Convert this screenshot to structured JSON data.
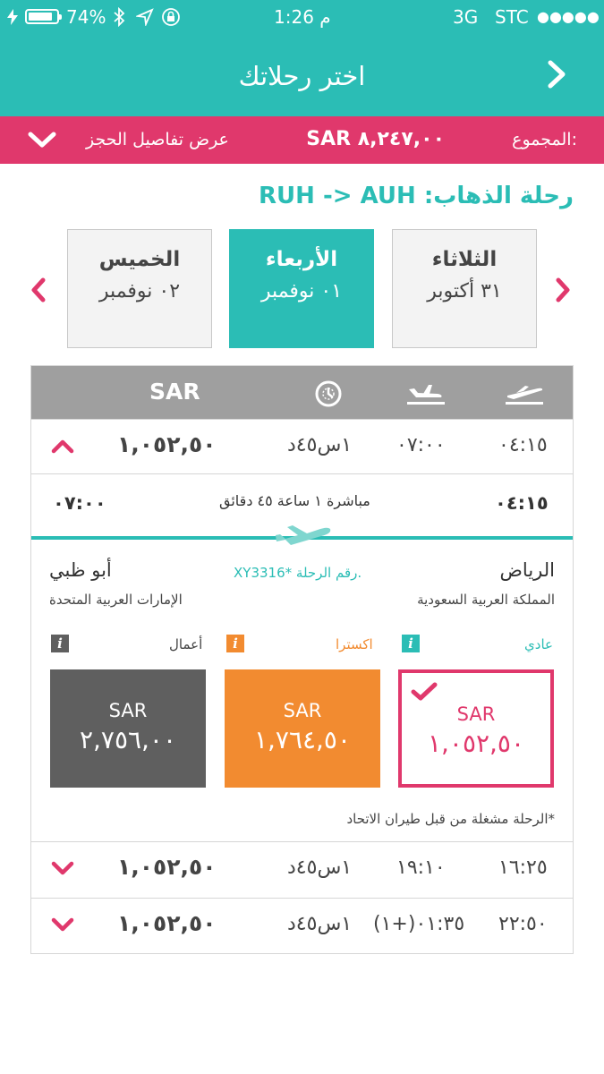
{
  "status_bar": {
    "battery": "74%",
    "time": "1:26 م",
    "network": "3G",
    "carrier": "STC",
    "signal": "●●●●●"
  },
  "header": {
    "title": "اختر رحلاتك"
  },
  "total_bar": {
    "total_label": "المجموع:",
    "total_amount": "SAR ٨,٢٤٧,٠٠",
    "details_label": "عرض تفاصيل الحجز"
  },
  "route": {
    "label": "رحلة الذهاب:",
    "path": "RUH -> AUH"
  },
  "days": [
    {
      "name": "الثلاثاء",
      "date": "٣١ أكتوبر"
    },
    {
      "name": "الأربعاء",
      "date": "٠١ نوفمبر",
      "selected": true
    },
    {
      "name": "الخميس",
      "date": "٠٢ نوفمبر"
    }
  ],
  "table": {
    "currency_header": "SAR",
    "flights": [
      {
        "dep": "٠٤:١٥",
        "arr": "٠٧:٠٠",
        "duration": "١س٤٥د",
        "price": "١,٠٥٢,٥٠",
        "expanded": true
      },
      {
        "dep": "١٦:٢٥",
        "arr": "١٩:١٠",
        "duration": "١س٤٥د",
        "price": "١,٠٥٢,٥٠",
        "expanded": false
      },
      {
        "dep": "٢٢:٥٠",
        "arr": "٠١:٣٥(+١)",
        "duration": "١س٤٥د",
        "price": "١,٠٥٢,٥٠",
        "expanded": false
      }
    ],
    "detail": {
      "dep_time": "٠٤:١٥",
      "arr_time": "٠٧:٠٠",
      "stops": "مباشرة ١ ساعة ٤٥ دقائق",
      "origin_city": "الرياض",
      "origin_country": "المملكة العربية السعودية",
      "dest_city": "أبو ظبي",
      "dest_country": "الإمارات العربية المتحدة",
      "flight_no_label": "رقم الرحلة.",
      "flight_no": "XY3316*",
      "fares": [
        {
          "name": "عادي",
          "currency": "SAR",
          "amount": "١,٠٥٢,٥٠",
          "color": "#e0386c",
          "selected": true
        },
        {
          "name": "اكسترا",
          "currency": "SAR",
          "amount": "١,٧٦٤,٥٠",
          "color": "#f28b30",
          "selected": false
        },
        {
          "name": "أعمال",
          "currency": "SAR",
          "amount": "٢,٧٥٦,٠٠",
          "color": "#5f5f5f",
          "selected": false
        }
      ],
      "info_glyph": "i",
      "note": "*الرحلة مشغلة من قبل طيران الاتحاد"
    }
  },
  "colors": {
    "teal": "#2bbdb5",
    "pink": "#e0386c",
    "orange": "#f28b30",
    "gray": "#5f5f5f"
  }
}
